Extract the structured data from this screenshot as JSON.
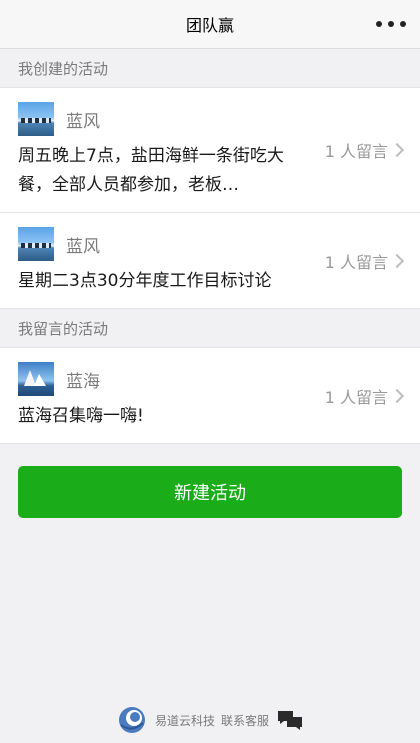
{
  "header": {
    "title": "团队赢",
    "more_icon": "more-dots-icon"
  },
  "sections": {
    "created": {
      "title": "我创建的活动",
      "items": [
        {
          "avatar": "lake-photo",
          "name": "蓝风",
          "text": "周五晚上7点，盐田海鲜一条街吃大餐，全部人员都参加，老板…",
          "comments": "1 人留言"
        },
        {
          "avatar": "lake-photo",
          "name": "蓝风",
          "text": "星期二3点30分年度工作目标讨论",
          "comments": "1 人留言"
        }
      ]
    },
    "commented": {
      "title": "我留言的活动",
      "items": [
        {
          "avatar": "opera-house-photo",
          "name": "蓝海",
          "text": "蓝海召集嗨一嗨!",
          "comments": "1 人留言"
        }
      ]
    }
  },
  "actions": {
    "create_label": "新建活动",
    "create_color": "#1aac19"
  },
  "footer": {
    "company": "易道云科技",
    "service": "联系客服",
    "logo_icon": "company-logo-icon",
    "chat_icon": "chat-bubbles-icon"
  }
}
